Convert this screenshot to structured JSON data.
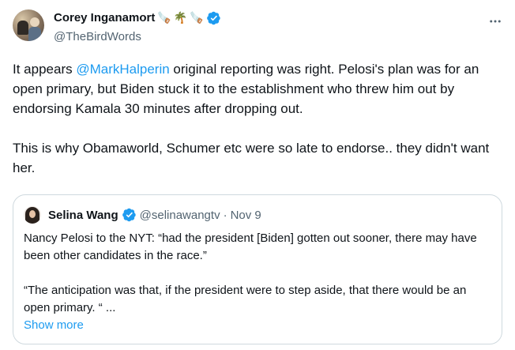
{
  "author": {
    "name": "Corey Inganamort",
    "emojis": [
      "🪚",
      "🌴",
      "🪚"
    ],
    "handle": "@TheBirdWords"
  },
  "tweet": {
    "paragraph1_before": "It appears ",
    "mention": "@MarkHalperin",
    "paragraph1_after": " original reporting was right.  Pelosi's plan was for an open primary, but Biden stuck it to the establishment who threw him out by endorsing Kamala 30 minutes after dropping out.",
    "paragraph2": "This is why Obamaworld, Schumer etc were so late to endorse.. they didn't want her."
  },
  "quote": {
    "name": "Selina Wang",
    "handle": "@selinawangtv",
    "dot": "·",
    "date": "Nov 9",
    "paragraph1": "Nancy Pelosi to the NYT:  “had the president [Biden] gotten out sooner, there may have been other candidates in the race.”",
    "paragraph2": "“The anticipation was that, if the president were to step aside, that there would be an open primary. “ ...",
    "show_more": "Show more"
  },
  "colors": {
    "accent": "#1d9bf0",
    "secondary_text": "#536471",
    "border": "#cfd9de"
  },
  "icons": {
    "verified": "verified-badge-icon",
    "more": "more-horizontal-icon"
  }
}
